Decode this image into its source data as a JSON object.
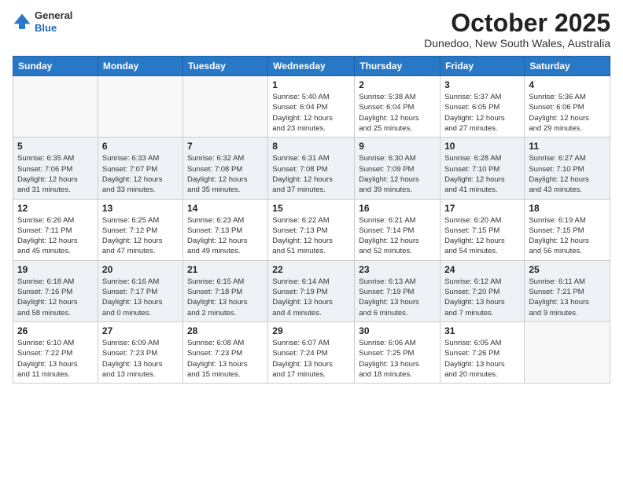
{
  "header": {
    "logo_line1": "General",
    "logo_line2": "Blue",
    "month": "October 2025",
    "location": "Dunedoo, New South Wales, Australia"
  },
  "weekdays": [
    "Sunday",
    "Monday",
    "Tuesday",
    "Wednesday",
    "Thursday",
    "Friday",
    "Saturday"
  ],
  "weeks": [
    [
      {
        "day": "",
        "info": ""
      },
      {
        "day": "",
        "info": ""
      },
      {
        "day": "",
        "info": ""
      },
      {
        "day": "1",
        "info": "Sunrise: 5:40 AM\nSunset: 6:04 PM\nDaylight: 12 hours\nand 23 minutes."
      },
      {
        "day": "2",
        "info": "Sunrise: 5:38 AM\nSunset: 6:04 PM\nDaylight: 12 hours\nand 25 minutes."
      },
      {
        "day": "3",
        "info": "Sunrise: 5:37 AM\nSunset: 6:05 PM\nDaylight: 12 hours\nand 27 minutes."
      },
      {
        "day": "4",
        "info": "Sunrise: 5:36 AM\nSunset: 6:06 PM\nDaylight: 12 hours\nand 29 minutes."
      }
    ],
    [
      {
        "day": "5",
        "info": "Sunrise: 6:35 AM\nSunset: 7:06 PM\nDaylight: 12 hours\nand 31 minutes."
      },
      {
        "day": "6",
        "info": "Sunrise: 6:33 AM\nSunset: 7:07 PM\nDaylight: 12 hours\nand 33 minutes."
      },
      {
        "day": "7",
        "info": "Sunrise: 6:32 AM\nSunset: 7:08 PM\nDaylight: 12 hours\nand 35 minutes."
      },
      {
        "day": "8",
        "info": "Sunrise: 6:31 AM\nSunset: 7:08 PM\nDaylight: 12 hours\nand 37 minutes."
      },
      {
        "day": "9",
        "info": "Sunrise: 6:30 AM\nSunset: 7:09 PM\nDaylight: 12 hours\nand 39 minutes."
      },
      {
        "day": "10",
        "info": "Sunrise: 6:28 AM\nSunset: 7:10 PM\nDaylight: 12 hours\nand 41 minutes."
      },
      {
        "day": "11",
        "info": "Sunrise: 6:27 AM\nSunset: 7:10 PM\nDaylight: 12 hours\nand 43 minutes."
      }
    ],
    [
      {
        "day": "12",
        "info": "Sunrise: 6:26 AM\nSunset: 7:11 PM\nDaylight: 12 hours\nand 45 minutes."
      },
      {
        "day": "13",
        "info": "Sunrise: 6:25 AM\nSunset: 7:12 PM\nDaylight: 12 hours\nand 47 minutes."
      },
      {
        "day": "14",
        "info": "Sunrise: 6:23 AM\nSunset: 7:13 PM\nDaylight: 12 hours\nand 49 minutes."
      },
      {
        "day": "15",
        "info": "Sunrise: 6:22 AM\nSunset: 7:13 PM\nDaylight: 12 hours\nand 51 minutes."
      },
      {
        "day": "16",
        "info": "Sunrise: 6:21 AM\nSunset: 7:14 PM\nDaylight: 12 hours\nand 52 minutes."
      },
      {
        "day": "17",
        "info": "Sunrise: 6:20 AM\nSunset: 7:15 PM\nDaylight: 12 hours\nand 54 minutes."
      },
      {
        "day": "18",
        "info": "Sunrise: 6:19 AM\nSunset: 7:15 PM\nDaylight: 12 hours\nand 56 minutes."
      }
    ],
    [
      {
        "day": "19",
        "info": "Sunrise: 6:18 AM\nSunset: 7:16 PM\nDaylight: 12 hours\nand 58 minutes."
      },
      {
        "day": "20",
        "info": "Sunrise: 6:16 AM\nSunset: 7:17 PM\nDaylight: 13 hours\nand 0 minutes."
      },
      {
        "day": "21",
        "info": "Sunrise: 6:15 AM\nSunset: 7:18 PM\nDaylight: 13 hours\nand 2 minutes."
      },
      {
        "day": "22",
        "info": "Sunrise: 6:14 AM\nSunset: 7:19 PM\nDaylight: 13 hours\nand 4 minutes."
      },
      {
        "day": "23",
        "info": "Sunrise: 6:13 AM\nSunset: 7:19 PM\nDaylight: 13 hours\nand 6 minutes."
      },
      {
        "day": "24",
        "info": "Sunrise: 6:12 AM\nSunset: 7:20 PM\nDaylight: 13 hours\nand 7 minutes."
      },
      {
        "day": "25",
        "info": "Sunrise: 6:11 AM\nSunset: 7:21 PM\nDaylight: 13 hours\nand 9 minutes."
      }
    ],
    [
      {
        "day": "26",
        "info": "Sunrise: 6:10 AM\nSunset: 7:22 PM\nDaylight: 13 hours\nand 11 minutes."
      },
      {
        "day": "27",
        "info": "Sunrise: 6:09 AM\nSunset: 7:23 PM\nDaylight: 13 hours\nand 13 minutes."
      },
      {
        "day": "28",
        "info": "Sunrise: 6:08 AM\nSunset: 7:23 PM\nDaylight: 13 hours\nand 15 minutes."
      },
      {
        "day": "29",
        "info": "Sunrise: 6:07 AM\nSunset: 7:24 PM\nDaylight: 13 hours\nand 17 minutes."
      },
      {
        "day": "30",
        "info": "Sunrise: 6:06 AM\nSunset: 7:25 PM\nDaylight: 13 hours\nand 18 minutes."
      },
      {
        "day": "31",
        "info": "Sunrise: 6:05 AM\nSunset: 7:26 PM\nDaylight: 13 hours\nand 20 minutes."
      },
      {
        "day": "",
        "info": ""
      }
    ]
  ]
}
